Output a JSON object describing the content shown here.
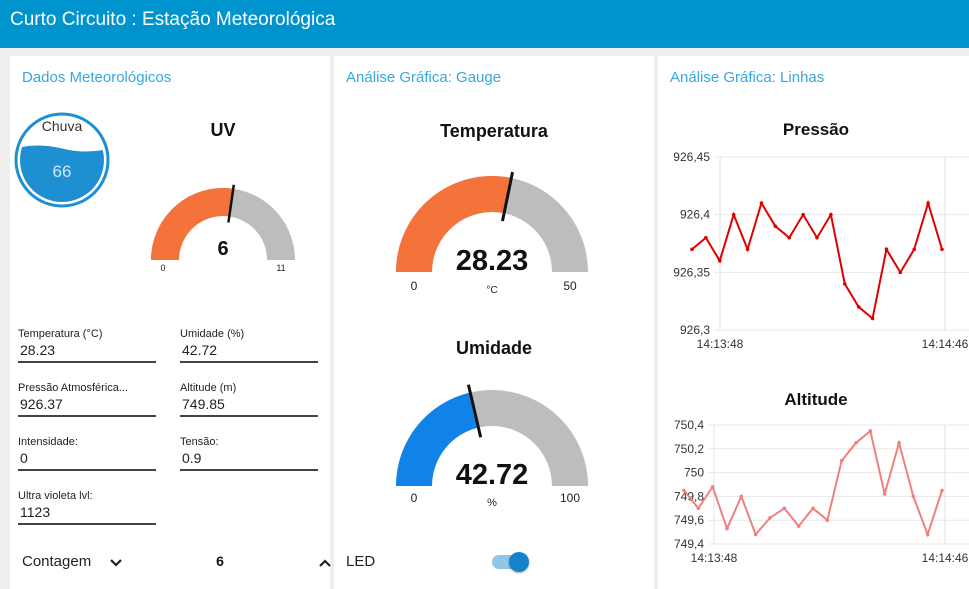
{
  "header": {
    "title": "Curto Circuito : Estação Meteorológica"
  },
  "colors": {
    "header": "#0094ce",
    "accent": "#34a8e0",
    "temp": "#f3733a",
    "humidity": "#1183e8",
    "gauge_bg": "#bdbdbd",
    "pressure_line": "#e00000",
    "altitude_line": "#f08080"
  },
  "panel1": {
    "title": "Dados Meteorológicos",
    "rain": {
      "label": "Chuva",
      "value": "66",
      "level": 66
    },
    "uv": {
      "title": "UV",
      "value": "6",
      "min": "0",
      "max": "11",
      "level": 6
    },
    "fields": [
      {
        "label": "Temperatura (°C)",
        "value": "28.23"
      },
      {
        "label": "Umidade (%)",
        "value": "42.72"
      },
      {
        "label": "Pressão Atmosférica...",
        "value": "926.37"
      },
      {
        "label": "Altitude (m)",
        "value": "749.85"
      },
      {
        "label": "Intensidade:",
        "value": "0"
      },
      {
        "label": "Tensão:",
        "value": "0.9"
      },
      {
        "label": "Ultra violeta lvl:",
        "value": "1123"
      }
    ],
    "counter": {
      "label": "Contagem",
      "value": "6"
    }
  },
  "panel2": {
    "title": "Análise Gráfica: Gauge",
    "temperature": {
      "title": "Temperatura",
      "value": "28.23",
      "min": "0",
      "max": "50",
      "unit": "°C",
      "level": 28.23
    },
    "humidity": {
      "title": "Umidade",
      "value": "42.72",
      "min": "0",
      "max": "100",
      "unit": "%",
      "level": 42.72
    },
    "led": {
      "label": "LED",
      "on": true
    }
  },
  "panel3": {
    "title": "Análise Gráfica: Linhas"
  },
  "chart_data": [
    {
      "type": "line",
      "title": "Pressão",
      "x_ticks": [
        "14:13:48",
        "14:14:46"
      ],
      "ylim": [
        926.3,
        926.45
      ],
      "y_ticks": [
        "926,45",
        "926,4",
        "926,35",
        "926,3"
      ],
      "grid": true,
      "series": [
        {
          "values": [
            926.37,
            926.38,
            926.36,
            926.4,
            926.37,
            926.41,
            926.39,
            926.38,
            926.4,
            926.38,
            926.4,
            926.34,
            926.32,
            926.31,
            926.37,
            926.35,
            926.37,
            926.41,
            926.37
          ]
        }
      ]
    },
    {
      "type": "line",
      "title": "Altitude",
      "x_ticks": [
        "14:13:48",
        "14:14:46"
      ],
      "ylim": [
        749.4,
        750.4
      ],
      "y_ticks": [
        "750,4",
        "750,2",
        "750",
        "749,8",
        "749,6",
        "749,4"
      ],
      "grid": true,
      "series": [
        {
          "values": [
            749.85,
            749.7,
            749.88,
            749.53,
            749.8,
            749.48,
            749.62,
            749.7,
            749.55,
            749.7,
            749.6,
            750.1,
            750.25,
            750.35,
            749.82,
            750.25,
            749.8,
            749.48,
            749.85
          ]
        }
      ]
    }
  ]
}
